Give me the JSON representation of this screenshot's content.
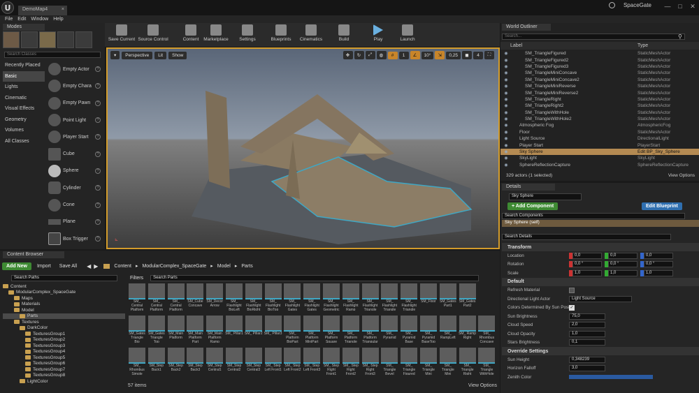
{
  "app": {
    "doc_tab": "DemoMap4",
    "project": "SpaceGate"
  },
  "menu": [
    "File",
    "Edit",
    "Window",
    "Help"
  ],
  "modes": {
    "tab": "Modes",
    "search_placeholder": "Search Classes",
    "categories": [
      "Recently Placed",
      "Basic",
      "Lights",
      "Cinematic",
      "Visual Effects",
      "Geometry",
      "Volumes",
      "All Classes"
    ],
    "selected_category": "Basic",
    "items": [
      "Empty Actor",
      "Empty Chara",
      "Empty Pawn",
      "Point Light",
      "Player Start",
      "Cube",
      "Sphere",
      "Cylinder",
      "Cone",
      "Plane",
      "Box Trigger"
    ]
  },
  "toolbar": [
    "Save Current",
    "Source Control",
    "Content",
    "Marketplace",
    "Settings",
    "Blueprints",
    "Cinematics",
    "Build",
    "Play",
    "Launch"
  ],
  "viewport": {
    "buttons": [
      "Perspective",
      "Lit",
      "Show"
    ],
    "snap": [
      "1",
      "10°",
      "0,25",
      "4"
    ]
  },
  "outliner": {
    "tab": "World Outliner",
    "search_placeholder": "Search...",
    "col_label": "Label",
    "col_type": "Type",
    "rows": [
      {
        "label": "SM_TriangleFigured",
        "type": "StaticMeshActor"
      },
      {
        "label": "SM_TriangleFigured2",
        "type": "StaticMeshActor"
      },
      {
        "label": "SM_TriangleFigured3",
        "type": "StaticMeshActor"
      },
      {
        "label": "SM_TriangleMiniConcave",
        "type": "StaticMeshActor"
      },
      {
        "label": "SM_TriangleMiniConcave2",
        "type": "StaticMeshActor"
      },
      {
        "label": "SM_TriangleMiniReverse",
        "type": "StaticMeshActor"
      },
      {
        "label": "SM_TriangleMiniReverse2",
        "type": "StaticMeshActor"
      },
      {
        "label": "SM_TriangleRight",
        "type": "StaticMeshActor"
      },
      {
        "label": "SM_TriangleRight2",
        "type": "StaticMeshActor"
      },
      {
        "label": "SM_TriangleWithHole",
        "type": "StaticMeshActor"
      },
      {
        "label": "SM_TriangleWithHole2",
        "type": "StaticMeshActor"
      },
      {
        "label": "Atmospheric Fog",
        "type": "AtmosphericFog"
      },
      {
        "label": "Floor",
        "type": "StaticMeshActor"
      },
      {
        "label": "Light Source",
        "type": "DirectionalLight"
      },
      {
        "label": "Player Start",
        "type": "PlayerStart"
      },
      {
        "label": "Sky Sphere",
        "type": "Edit BP_Sky_Sphere"
      },
      {
        "label": "SkyLight",
        "type": "SkyLight"
      },
      {
        "label": "SphereReflectionCapture",
        "type": "SphereReflectionCapture"
      }
    ],
    "selected_index": 15,
    "footer": "329 actors (1 selected)",
    "view_options": "View Options"
  },
  "details": {
    "tab": "Details",
    "name": "Sky Sphere",
    "add_component": "+ Add Component",
    "edit_blueprint": "Edit Blueprint",
    "search_components": "Search Components",
    "self": "Sky Sphere (self)",
    "search_details": "Search Details",
    "transform": "Transform",
    "location": {
      "label": "Location",
      "x": "0,0",
      "y": "0,0",
      "z": "0,0"
    },
    "rotation": {
      "label": "Rotation",
      "x": "0,0 °",
      "y": "0,0 °",
      "z": "0,0 °"
    },
    "scale": {
      "label": "Scale",
      "x": "1,0",
      "y": "1,0",
      "z": "1,0"
    },
    "default": "Default",
    "refresh": "Refresh Material",
    "dir_light": "Directional Light Actor",
    "dir_light_value": "Light Source",
    "colors_by_sun": "Colors Determined By Sun Position",
    "sun_brightness": {
      "label": "Sun Brightness",
      "value": "75,0"
    },
    "cloud_speed": {
      "label": "Cloud Speed",
      "value": "2,0"
    },
    "cloud_opacity": {
      "label": "Cloud Opacity",
      "value": "1,0"
    },
    "stars": {
      "label": "Stars Brightness",
      "value": "0,1"
    },
    "override": "Override Settings",
    "sun_height": {
      "label": "Sun Height",
      "value": "0,348239"
    },
    "horizon": {
      "label": "Horizon Falloff",
      "value": "3,0"
    },
    "zenith": "Zenith Color"
  },
  "content": {
    "tab": "Content Browser",
    "add_new": "Add New",
    "import": "Import",
    "save_all": "Save All",
    "path": [
      "Content",
      "ModularComplex_SpaceGate",
      "Model",
      "Parts"
    ],
    "search_paths": "Search Paths",
    "filters": "Filters",
    "search_parts": "Search Parts",
    "tree": [
      "Content",
      "ModularComplex_SpaceGate",
      "Maps",
      "Materials",
      "Model",
      "Parts",
      "Textures",
      "DarkColor",
      "TexturesGroup1",
      "TexturesGroup2",
      "TexturesGroup3",
      "TexturesGroup4",
      "TexturesGroup5",
      "TexturesGroup6",
      "TexturesGroup7",
      "TexturesGroup8",
      "LightColor"
    ],
    "assets": [
      "SM_ Central Platform",
      "SM_ Central Platform",
      "SM_ Central Platform",
      "SM_Cube Concave",
      "SM_Decor Arrow",
      "SM_ Flashlight BioLeft",
      "SM_ Flashlight BioRight",
      "SM_ Flashlight BioTop",
      "SM_ Flashlight Gates",
      "SM_ Flashlight Gates",
      "SM_ Flashlight Geometric",
      "SM_ Flashlight Ramp",
      "SM_ Flashlight Triangle",
      "SM_ Flashlight Triangle",
      "SM_ Flashlight Triangle",
      "SM_Floor",
      "SM_Gates Part1",
      "SM_Gates Part2",
      "SM_Gates Triangle Bio",
      "SM_Gates Triangle Top",
      "SM_Main Platform",
      "SM_Main Platform Part",
      "SM_Main Platform Ramp",
      "SM_ Pillar1",
      "SM_ Pillar2",
      "SM_ Pillar3",
      "SM_ Platform BioPart",
      "SM_ Platform MiniPart",
      "SM_ Platform Square",
      "SM_ Platform Triangle",
      "SM_ Platform Triangular",
      "SM_ Pyramid",
      "SM_ Pyramid Base",
      "SM_ Pyramid BaseTop",
      "SM_ RampLeft",
      "SM_ Ramp Right",
      "SM_ Rhombus Concave",
      "SM_ Rhombus Simple",
      "SM_Step Back1",
      "SM_Step Back2",
      "SM_Step Back3",
      "SM_Step Central1",
      "SM_Step Central2",
      "SM_Step Central3",
      "SM_ Step Left Front1",
      "SM_ Step Left Front2",
      "SM_ Step Left Front3",
      "SM_ Step Right Front1",
      "SM_ Step Right Front2",
      "SM_ Step Right Front3",
      "SM_ Triangle Bevel",
      "SM_ Triangle Figured",
      "SM_ Triangle Mini",
      "SM_ Triangle Mini",
      "SM_ Triangle Right",
      "SM_ Triangle WithHole"
    ],
    "count": "57 items",
    "view_options": "View Options"
  }
}
